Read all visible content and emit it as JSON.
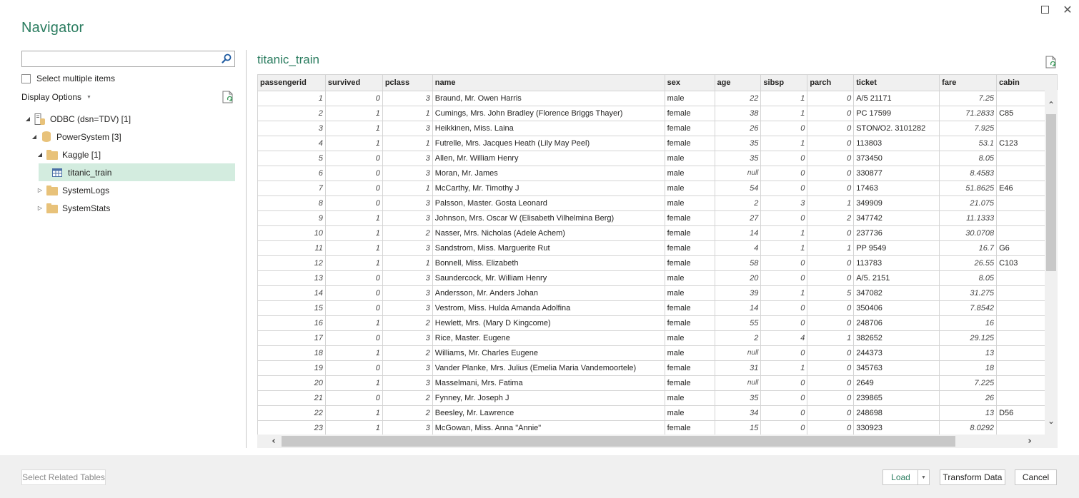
{
  "window": {
    "title": "Navigator",
    "maximize_icon": "maximize-icon",
    "close_icon": "close-icon"
  },
  "left_pane": {
    "search": {
      "value": "",
      "placeholder": "",
      "icon": "search-icon"
    },
    "select_multiple_label": "Select multiple items",
    "select_multiple_checked": false,
    "display_options_label": "Display Options",
    "refresh_icon": "refresh-icon",
    "tree": [
      {
        "label": "ODBC (dsn=TDV) [1]",
        "level": 0,
        "expanded": true,
        "icon": "server-icon"
      },
      {
        "label": "PowerSystem [3]",
        "level": 1,
        "expanded": true,
        "icon": "database-icon"
      },
      {
        "label": "Kaggle [1]",
        "level": 2,
        "expanded": true,
        "icon": "folder-icon"
      },
      {
        "label": "titanic_train",
        "level": 3,
        "selected": true,
        "icon": "table-icon"
      },
      {
        "label": "SystemLogs",
        "level": 2,
        "expanded": false,
        "icon": "folder-icon"
      },
      {
        "label": "SystemStats",
        "level": 2,
        "expanded": false,
        "icon": "folder-icon"
      }
    ]
  },
  "preview": {
    "title": "titanic_train",
    "columns": [
      "passengerid",
      "survived",
      "pclass",
      "name",
      "sex",
      "age",
      "sibsp",
      "parch",
      "ticket",
      "fare",
      "cabin"
    ],
    "rows": [
      [
        "1",
        "0",
        "3",
        "Braund, Mr. Owen Harris",
        "male",
        "22",
        "1",
        "0",
        "A/5 21171",
        "7.25",
        ""
      ],
      [
        "2",
        "1",
        "1",
        "Cumings, Mrs. John Bradley (Florence Briggs Thayer)",
        "female",
        "38",
        "1",
        "0",
        "PC 17599",
        "71.2833",
        "C85"
      ],
      [
        "3",
        "1",
        "3",
        "Heikkinen, Miss. Laina",
        "female",
        "26",
        "0",
        "0",
        "STON/O2. 3101282",
        "7.925",
        ""
      ],
      [
        "4",
        "1",
        "1",
        "Futrelle, Mrs. Jacques Heath (Lily May Peel)",
        "female",
        "35",
        "1",
        "0",
        "113803",
        "53.1",
        "C123"
      ],
      [
        "5",
        "0",
        "3",
        "Allen, Mr. William Henry",
        "male",
        "35",
        "0",
        "0",
        "373450",
        "8.05",
        ""
      ],
      [
        "6",
        "0",
        "3",
        "Moran, Mr. James",
        "male",
        "null",
        "0",
        "0",
        "330877",
        "8.4583",
        ""
      ],
      [
        "7",
        "0",
        "1",
        "McCarthy, Mr. Timothy J",
        "male",
        "54",
        "0",
        "0",
        "17463",
        "51.8625",
        "E46"
      ],
      [
        "8",
        "0",
        "3",
        "Palsson, Master. Gosta Leonard",
        "male",
        "2",
        "3",
        "1",
        "349909",
        "21.075",
        ""
      ],
      [
        "9",
        "1",
        "3",
        "Johnson, Mrs. Oscar W (Elisabeth Vilhelmina Berg)",
        "female",
        "27",
        "0",
        "2",
        "347742",
        "11.1333",
        ""
      ],
      [
        "10",
        "1",
        "2",
        "Nasser, Mrs. Nicholas (Adele Achem)",
        "female",
        "14",
        "1",
        "0",
        "237736",
        "30.0708",
        ""
      ],
      [
        "11",
        "1",
        "3",
        "Sandstrom, Miss. Marguerite Rut",
        "female",
        "4",
        "1",
        "1",
        "PP 9549",
        "16.7",
        "G6"
      ],
      [
        "12",
        "1",
        "1",
        "Bonnell, Miss. Elizabeth",
        "female",
        "58",
        "0",
        "0",
        "113783",
        "26.55",
        "C103"
      ],
      [
        "13",
        "0",
        "3",
        "Saundercock, Mr. William Henry",
        "male",
        "20",
        "0",
        "0",
        "A/5. 2151",
        "8.05",
        ""
      ],
      [
        "14",
        "0",
        "3",
        "Andersson, Mr. Anders Johan",
        "male",
        "39",
        "1",
        "5",
        "347082",
        "31.275",
        ""
      ],
      [
        "15",
        "0",
        "3",
        "Vestrom, Miss. Hulda Amanda Adolfina",
        "female",
        "14",
        "0",
        "0",
        "350406",
        "7.8542",
        ""
      ],
      [
        "16",
        "1",
        "2",
        "Hewlett, Mrs. (Mary D Kingcome)",
        "female",
        "55",
        "0",
        "0",
        "248706",
        "16",
        ""
      ],
      [
        "17",
        "0",
        "3",
        "Rice, Master. Eugene",
        "male",
        "2",
        "4",
        "1",
        "382652",
        "29.125",
        ""
      ],
      [
        "18",
        "1",
        "2",
        "Williams, Mr. Charles Eugene",
        "male",
        "null",
        "0",
        "0",
        "244373",
        "13",
        ""
      ],
      [
        "19",
        "0",
        "3",
        "Vander Planke, Mrs. Julius (Emelia Maria Vandemoortele)",
        "female",
        "31",
        "1",
        "0",
        "345763",
        "18",
        ""
      ],
      [
        "20",
        "1",
        "3",
        "Masselmani, Mrs. Fatima",
        "female",
        "null",
        "0",
        "0",
        "2649",
        "7.225",
        ""
      ],
      [
        "21",
        "0",
        "2",
        "Fynney, Mr. Joseph J",
        "male",
        "35",
        "0",
        "0",
        "239865",
        "26",
        ""
      ],
      [
        "22",
        "1",
        "2",
        "Beesley, Mr. Lawrence",
        "male",
        "34",
        "0",
        "0",
        "248698",
        "13",
        "D56"
      ],
      [
        "23",
        "1",
        "3",
        "McGowan, Miss. Anna \"Annie\"",
        "female",
        "15",
        "0",
        "0",
        "330923",
        "8.0292",
        ""
      ]
    ],
    "numeric_columns": [
      0,
      1,
      2,
      5,
      6,
      7,
      9
    ]
  },
  "footer": {
    "select_related_label": "Select Related Tables",
    "load_label": "Load",
    "transform_label": "Transform Data",
    "cancel_label": "Cancel"
  },
  "colors": {
    "accent": "#2a7c5f",
    "selection": "#d3ecdf",
    "footer_bg": "#f0f0f0",
    "folder": "#e8c27a"
  }
}
